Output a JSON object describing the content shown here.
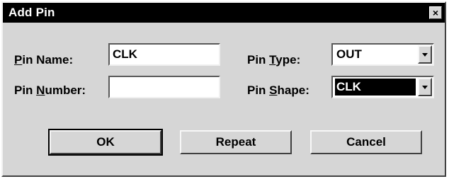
{
  "dialog": {
    "title": "Add Pin",
    "close_glyph": "×"
  },
  "fields": {
    "pin_name": {
      "label_prefix": "",
      "label_mnemonic": "P",
      "label_rest": "in Name:",
      "value": "CLK"
    },
    "pin_number": {
      "label_prefix": "Pin ",
      "label_mnemonic": "N",
      "label_rest": "umber:",
      "value": ""
    },
    "pin_type": {
      "label_prefix": "Pin ",
      "label_mnemonic": "T",
      "label_rest": "ype:",
      "value": "OUT"
    },
    "pin_shape": {
      "label_prefix": "Pin ",
      "label_mnemonic": "S",
      "label_rest": "hape:",
      "value": "CLK"
    }
  },
  "buttons": {
    "ok": "OK",
    "repeat": "Repeat",
    "cancel": "Cancel"
  },
  "icons": {
    "close": "close-icon",
    "dropdown": "chevron-down-icon"
  },
  "colors": {
    "title_bar": "#000000",
    "dialog_face": "#d6d6d6",
    "field_bg": "#ffffff",
    "selection_bg": "#000000"
  }
}
